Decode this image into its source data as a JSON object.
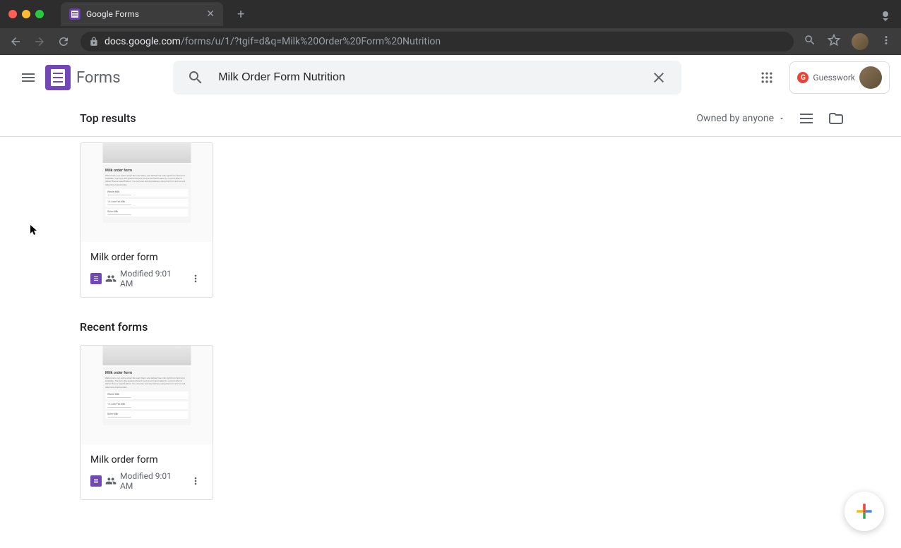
{
  "browser": {
    "tab_title": "Google Forms",
    "url_domain": "docs.google.com",
    "url_path": "/forms/u/1/?tgif=d&q=Milk%20Order%20Form%20Nutrition"
  },
  "header": {
    "app_name": "Forms",
    "search_value": "Milk Order Form Nutrition",
    "badge_label": "Guesswork"
  },
  "toolbar": {
    "results_label": "Top results",
    "ownership_label": "Owned by anyone"
  },
  "sections": {
    "recent_label": "Recent forms"
  },
  "top_results": [
    {
      "title": "Milk order form",
      "modified": "Modified 9:01 AM",
      "thumb_title": "Milk order form",
      "thumb_desc": "Welcome to our online shop! We want them, and deliver free milk right from farm and available. The farm, the guesswork and food recommend select to commit after to deliver flavour specification. You can also ask any delicacy using the form and we will determine it personally."
    }
  ],
  "recent_forms": [
    {
      "title": "Milk order form",
      "modified": "Modified 9:01 AM",
      "thumb_title": "Milk order form",
      "thumb_desc": "Welcome to our online shop! We want them, and deliver free milk right from farm and available. The farm, the guesswork and food recommend select to commit after to deliver flavour specification. You can also ask any delicacy using the form and we will determine it personally."
    }
  ]
}
